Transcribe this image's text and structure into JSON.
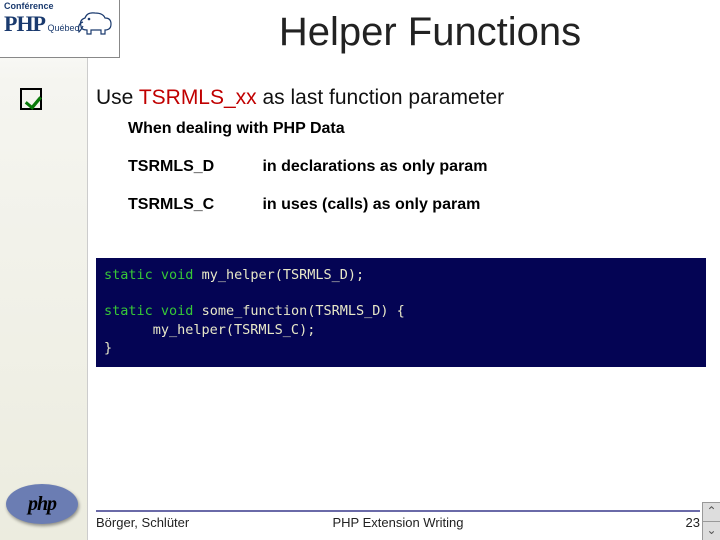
{
  "logo": {
    "line1": "Conférence",
    "brand": "PHP",
    "line2": "Québec"
  },
  "title": "Helper Functions",
  "bullet": {
    "pre": "Use ",
    "highlight": "TSRMLS_xx",
    "post": " as last function parameter"
  },
  "sub_when": "When dealing with PHP Data",
  "rows": [
    {
      "key": "TSRMLS_D",
      "desc": "in declarations as only param"
    },
    {
      "key": "TSRMLS_C",
      "desc": "in uses (calls) as only param"
    }
  ],
  "code": {
    "kw_static": "static",
    "kw_void": "void",
    "line1_rest": " my_helper(TSRMLS_D);",
    "line3_rest": " some_function(TSRMLS_D) {",
    "line4": "      my_helper(TSRMLS_C);",
    "line5": "}"
  },
  "php_pill": "php",
  "footer": {
    "authors": "Börger, Schlüter",
    "center": "PHP Extension Writing",
    "page": "23"
  },
  "nav": {
    "up": "⌃",
    "down": "⌄"
  }
}
